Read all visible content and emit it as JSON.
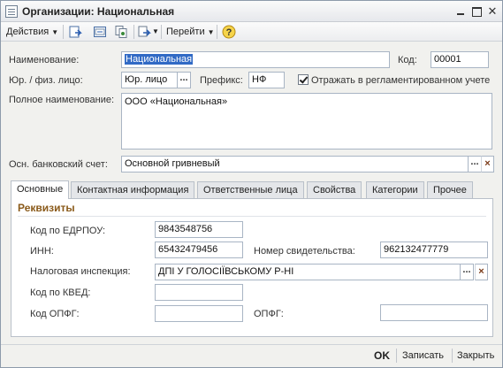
{
  "window": {
    "title": "Организации: Национальная"
  },
  "toolbar": {
    "actions_label": "Действия",
    "goto_label": "Перейти"
  },
  "form": {
    "name_label": "Наименование:",
    "name_value": "Национальная",
    "code_label": "Код:",
    "code_value": "00001",
    "entity_type_label": "Юр. / физ. лицо:",
    "entity_type_value": "Юр. лицо",
    "prefix_label": "Префикс:",
    "prefix_value": "НФ",
    "reflect_label": "Отражать в регламентированном учете",
    "reflect_checked": true,
    "full_name_label": "Полное наименование:",
    "full_name_value": "ООО «Национальная»",
    "bank_account_label": "Осн. банковский счет:",
    "bank_account_value": "Основной гривневый"
  },
  "tabs": [
    {
      "label": "Основные",
      "active": true
    },
    {
      "label": "Контактная информация",
      "active": false
    },
    {
      "label": "Ответственные лица",
      "active": false
    },
    {
      "label": "Свойства",
      "active": false
    },
    {
      "label": "Категории",
      "active": false
    },
    {
      "label": "Прочее",
      "active": false
    }
  ],
  "details": {
    "group_title": "Реквизиты",
    "edrpou_label": "Код по ЕДРПОУ:",
    "edrpou_value": "9843548756",
    "inn_label": "ИНН:",
    "inn_value": "65432479456",
    "cert_label": "Номер свидетельства:",
    "cert_value": "962132477779",
    "tax_label": "Налоговая инспекция:",
    "tax_value": "ДПІ У ГОЛОСІЇВСЬКОМУ Р-НІ",
    "kved_label": "Код по КВЕД:",
    "kved_value": "",
    "opfg_code_label": "Код ОПФГ:",
    "opfg_code_value": "",
    "opfg_label": "ОПФГ:",
    "opfg_value": ""
  },
  "bottom": {
    "ok_label": "OK",
    "save_label": "Записать",
    "close_label": "Закрыть"
  },
  "icons": {
    "dots": "...",
    "clear": "×"
  }
}
